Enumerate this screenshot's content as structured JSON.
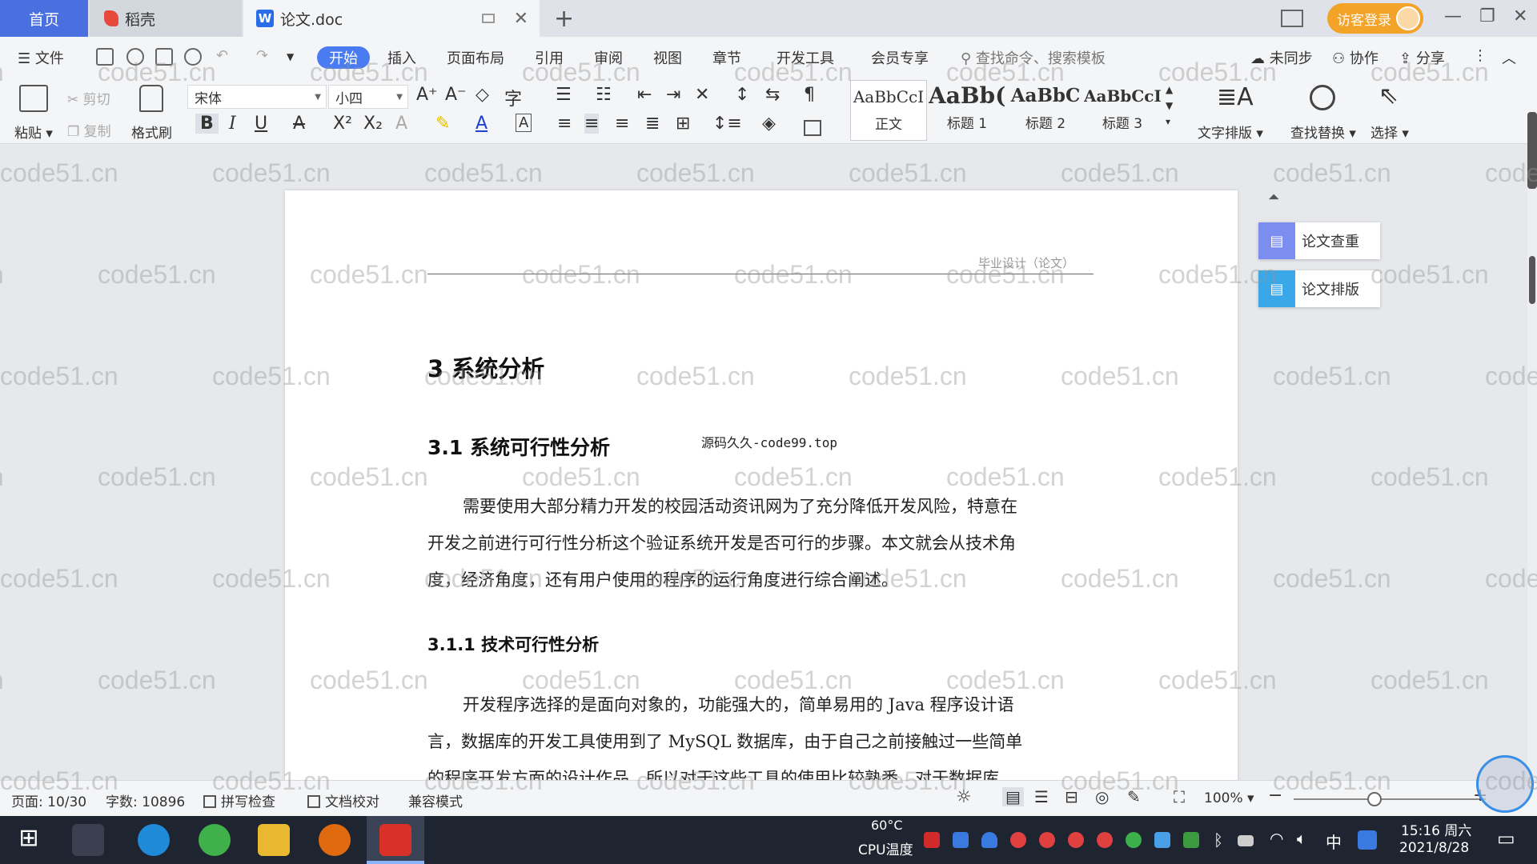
{
  "window": {
    "tabs": [
      {
        "label": "首页"
      },
      {
        "label": "稻壳"
      },
      {
        "label": "论文.doc"
      }
    ],
    "guest_login": "访客登录"
  },
  "menu": {
    "file": "文件",
    "items": [
      "开始",
      "插入",
      "页面布局",
      "引用",
      "审阅",
      "视图",
      "章节",
      "开发工具",
      "会员专享"
    ],
    "search_placeholder": "查找命令、搜索模板",
    "sync": "未同步",
    "collab": "协作",
    "share": "分享"
  },
  "ribbon": {
    "paste": "粘贴",
    "cut": "剪切",
    "copy": "复制",
    "format_painter": "格式刷",
    "font_name": "宋体",
    "font_size": "小四",
    "styles": [
      {
        "sample": "AaBbCcI",
        "label": "正文"
      },
      {
        "sample": "AaBb(",
        "label": "标题 1"
      },
      {
        "sample": "AaBbC",
        "label": "标题 2"
      },
      {
        "sample": "AaBbCcI",
        "label": "标题 3"
      }
    ],
    "text_layout": "文字排版",
    "find_replace": "查找替换",
    "select": "选择"
  },
  "document": {
    "header": "毕业设计（论文）",
    "heading1": "3  系统分析",
    "heading2": "3.1 系统可行性分析",
    "stamp": "源码久久-code99.top",
    "para1": [
      "需要使用大部分精力开发的校园活动资讯网为了充分降低开发风险，特意在",
      "开发之前进行可行性分析这个验证系统开发是否可行的步骤。本文就会从技术角",
      "度，经济角度，还有用户使用的程序的运行角度进行综合阐述。"
    ],
    "heading3": "3.1.1  技术可行性分析",
    "para2": [
      "开发程序选择的是面向对象的，功能强大的，简单易用的 Java 程序设计语",
      "言，数据库的开发工具使用到了 MySQL 数据库，由于自己之前接触过一些简单",
      "的程序开发方面的设计作品，所以对于这些工具的使用比较熟悉，对于数据库"
    ]
  },
  "side_panel": {
    "check": "论文查重",
    "layout": "论文排版"
  },
  "status": {
    "page": "页面: 10/30",
    "words": "字数: 10896",
    "spell": "拼写检查",
    "proof": "文档校对",
    "compat": "兼容模式",
    "zoom": "100%"
  },
  "taskbar": {
    "cpu_temp": "60°C",
    "cpu_label": "CPU温度",
    "ime": "中",
    "time": "15:16 周六",
    "date": "2021/8/28"
  },
  "watermark": "code51.cn",
  "colors": {
    "accent": "#4a7bf0",
    "home_tab": "#4a6fe0",
    "guest": "#f3a328",
    "check_btn": "#7b8ef0",
    "layout_btn": "#3aa8e8"
  }
}
